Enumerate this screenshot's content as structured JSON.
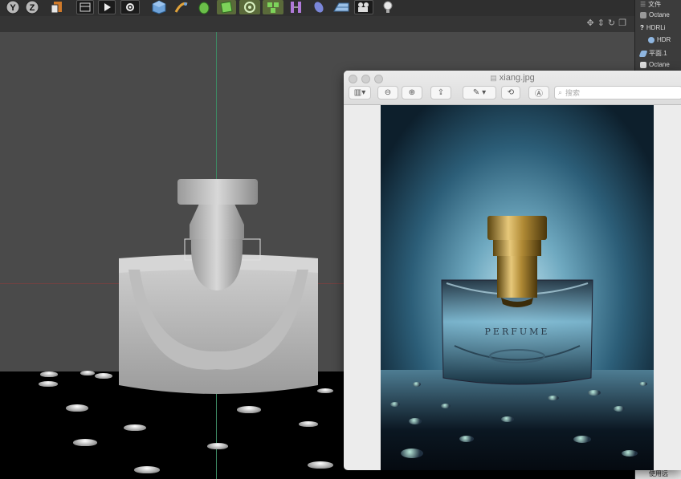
{
  "toolbar": {
    "axis_y": "Y",
    "axis_z": "Z"
  },
  "objects_panel": {
    "header": "文件",
    "items": [
      {
        "label": "Octane",
        "icon": "octane-icon"
      },
      {
        "label": "HDRLi",
        "icon": "question-icon"
      },
      {
        "label": "HDR",
        "icon": "sphere-icon"
      },
      {
        "label": "平面.1",
        "icon": "plane-icon"
      },
      {
        "label": "Octane",
        "icon": "octane-icon"
      }
    ],
    "status": "使用远"
  },
  "preview": {
    "title": "xiang.jpg",
    "search_placeholder": "搜索",
    "image_text": "PERFUME"
  },
  "colors": {
    "viewport_bg": "#4a4a4a",
    "floor": "#000000",
    "axis_green": "#3d8a63",
    "axis_red": "#8a3d3d"
  }
}
